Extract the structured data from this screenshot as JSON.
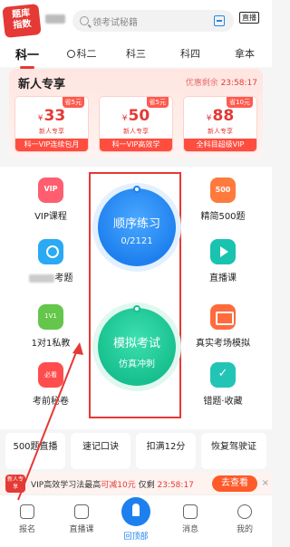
{
  "topbar": {
    "logo_line1": "题库",
    "logo_line2": "指数",
    "search_placeholder": "领考试秘籍",
    "live_label": "直播"
  },
  "tabs": [
    {
      "label": "科一"
    },
    {
      "label": "科二"
    },
    {
      "label": "科三"
    },
    {
      "label": "科四"
    },
    {
      "label": "拿本"
    }
  ],
  "newbie": {
    "title": "新人专享",
    "countdown_label": "优惠剩余",
    "countdown_value": "23:58:17",
    "coupons": [
      {
        "save": "省5元",
        "currency": "¥",
        "price": "33",
        "tag": "新人专享",
        "name": "科一VIP连续包月"
      },
      {
        "save": "省5元",
        "currency": "¥",
        "price": "50",
        "tag": "新人专享",
        "name": "科一VIP高效学"
      },
      {
        "save": "省10元",
        "currency": "¥",
        "price": "88",
        "tag": "新人专享",
        "name": "全科目超级VIP"
      }
    ]
  },
  "features": {
    "vip_course": "VIP课程",
    "top500": "精简500题",
    "exam_suffix": "考题",
    "live_course": "直播课",
    "one_on_one": "1对1私教",
    "real_exam_sim": "真实考场模拟",
    "pre_exam": "考前秘卷",
    "mistakes": "错题·收藏"
  },
  "practice": {
    "sequential_title": "顺序练习",
    "sequential_progress": "0/2121",
    "mock_title": "模拟考试",
    "mock_subtitle": "仿真冲刺"
  },
  "tiles": [
    {
      "label": "500题直播"
    },
    {
      "label": "速记口诀"
    },
    {
      "label": "扣满12分"
    },
    {
      "label": "恢复驾驶证"
    }
  ],
  "promo": {
    "badge_line1": "新人专享",
    "text_a": "VIP高效学习法最高",
    "text_red": "可减10元",
    "text_b": "仅剩",
    "countdown": "23:58:17",
    "button": "去查看",
    "close": "×"
  },
  "tabbar": [
    {
      "label": "报名"
    },
    {
      "label": "直播课"
    },
    {
      "label": "回顶部"
    },
    {
      "label": "消息"
    },
    {
      "label": "我的"
    }
  ],
  "colors": {
    "accent_red": "#e53935",
    "practice_blue": "#1e80ef",
    "practice_green": "#17c08e"
  }
}
